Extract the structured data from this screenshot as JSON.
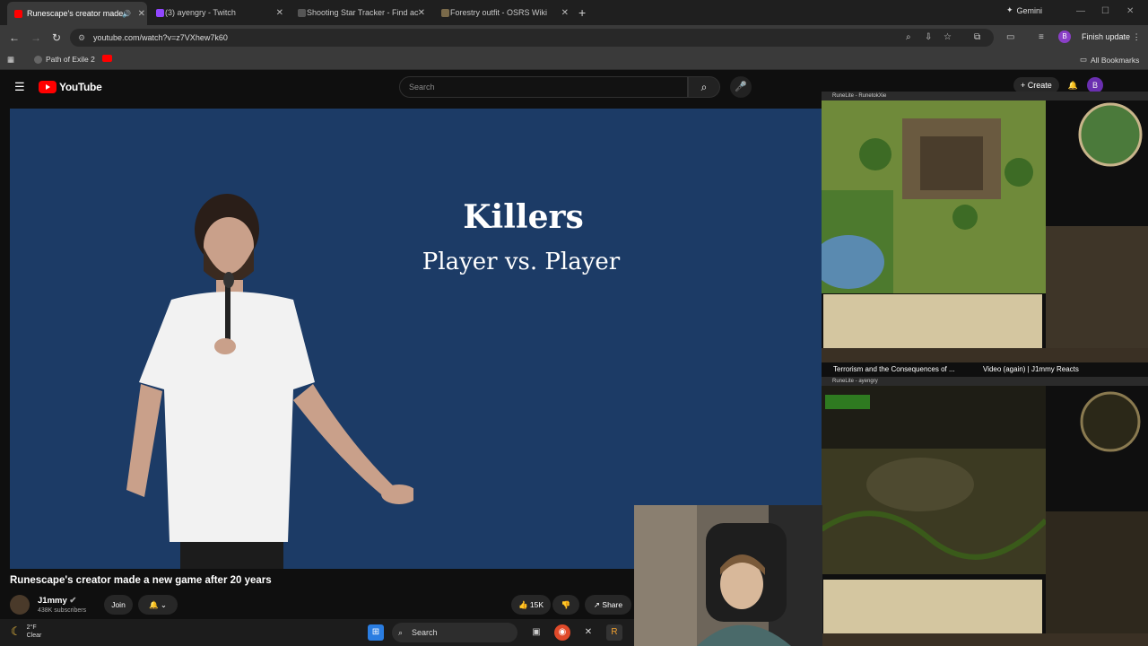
{
  "browser": {
    "tabs": [
      {
        "label": "Runescape's creator made",
        "color": "#ff0000"
      },
      {
        "label": "(3) ayengry - Twitch",
        "color": "#9146ff"
      },
      {
        "label": "Shooting Star Tracker - Find ac",
        "color": "#555555"
      },
      {
        "label": "Forestry outfit - OSRS Wiki",
        "color": "#7a6a4a"
      }
    ],
    "gemini_label": "Gemini",
    "url": "youtube.com/watch?v=z7VXhew7k60",
    "finish_update": "Finish update",
    "profile_initial": "B",
    "bookmarks": [
      {
        "label": "Path of Exile 2"
      }
    ],
    "all_bookmarks": "All Bookmarks"
  },
  "youtube": {
    "logo_text": "YouTube",
    "search_placeholder": "Search",
    "create_label": "Create",
    "profile_initial": "B",
    "slide": {
      "title": "Killers",
      "subtitle": "Player vs. Player"
    },
    "video_title": "Runescape's creator made a new game after 20 years",
    "channel_name": "J1mmy",
    "subscribers": "438K subscribers",
    "join_label": "Join",
    "likes": "15K",
    "share_label": "Share"
  },
  "streams": {
    "top_window_title": "RuneLite - RunetokXie",
    "bottom_window_title": "RuneLite - ayengry",
    "tile_left": "Terrorism and the Consequences of ...",
    "tile_right": "Video (again) | J1mmy Reacts"
  },
  "taskbar": {
    "temperature": "2°F",
    "condition": "Clear",
    "search_label": "Search"
  }
}
